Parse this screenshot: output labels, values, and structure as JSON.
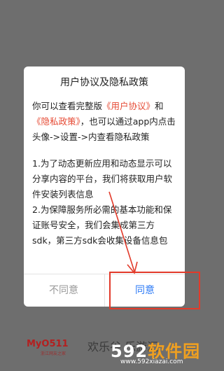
{
  "dialog": {
    "title": "用户协议及隐私政策",
    "p1_before": "你可以查看完整版",
    "p1_link1": "《用户协议》",
    "p1_and": "和",
    "p1_link2": "《隐私政策》",
    "p1_after": "，也可以通过app内点击头像->设置->内查看隐私政策",
    "p2_line1": "1.为了动态更新应用和动态显示可以分享内容的平台，我们将获取用户软件安装列表信息",
    "p2_line2": "2.为保障服务所必需的基本功能和保证账号安全，我们会集成第三方sdk，第三方sdk会收集设备信息包",
    "disagree_label": "不同意",
    "agree_label": "同意"
  },
  "footer": {
    "logo_left": "MyO511",
    "logo_left_sub": "浙江网友之家",
    "logo_script": "欢乐谷 乐游汇"
  },
  "watermark": {
    "number": "592",
    "text": "软件园",
    "url": "www.592xiazai.com"
  },
  "colors": {
    "overlay": "#6e6e6e",
    "link": "#e64a34",
    "agree": "#2f7cf6",
    "disagree": "#9a9a9a",
    "highlight": "#e23a2a"
  }
}
